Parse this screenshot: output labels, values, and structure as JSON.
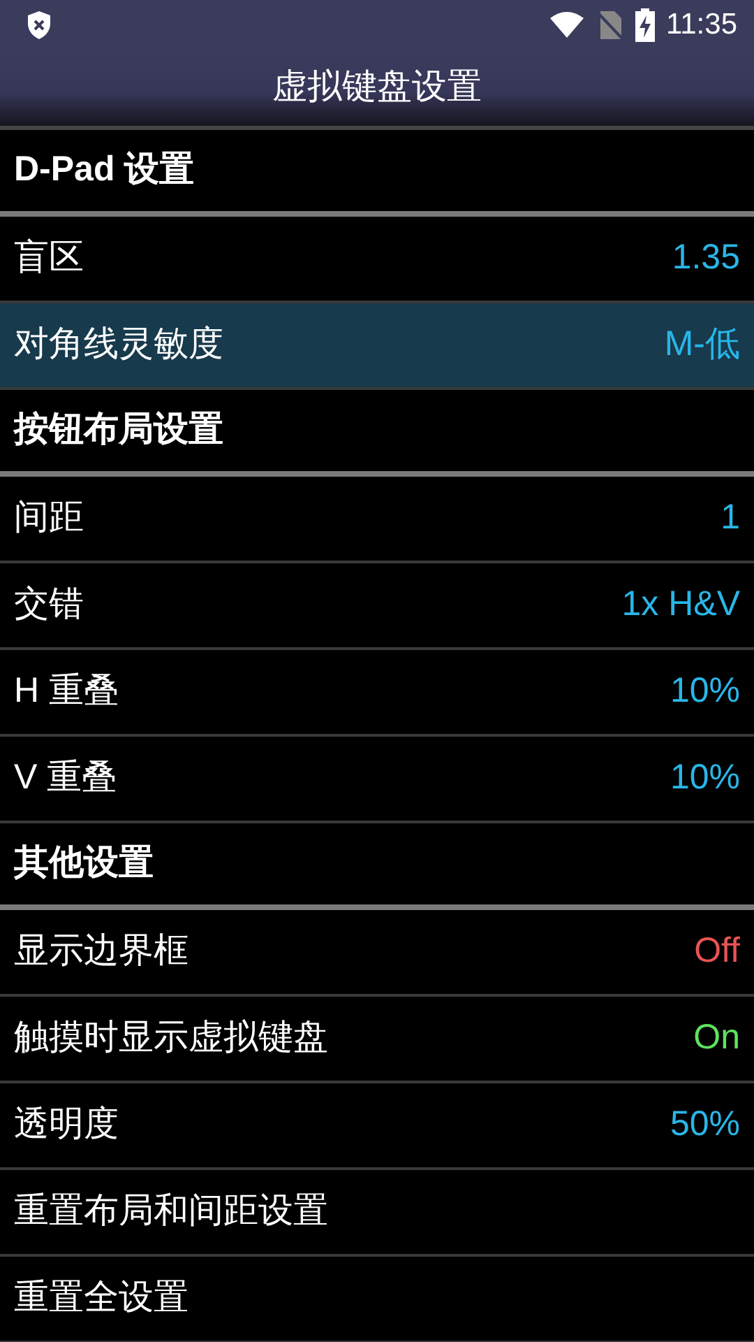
{
  "status_bar": {
    "time": "11:35"
  },
  "title": "虚拟键盘设置",
  "items": [
    {
      "kind": "header",
      "label": "D-Pad 设置"
    },
    {
      "kind": "setting",
      "label": "盲区",
      "value": "1.35",
      "color": "#29b6e8",
      "selected": false
    },
    {
      "kind": "setting",
      "label": "对角线灵敏度",
      "value": "M-低",
      "color": "#29b6e8",
      "selected": true
    },
    {
      "kind": "header",
      "label": "按钮布局设置"
    },
    {
      "kind": "setting",
      "label": "间距",
      "value": "1",
      "color": "#29b6e8",
      "selected": false
    },
    {
      "kind": "setting",
      "label": "交错",
      "value": "1x H&V",
      "color": "#29b6e8",
      "selected": false
    },
    {
      "kind": "setting",
      "label": "H 重叠",
      "value": "10%",
      "color": "#29b6e8",
      "selected": false
    },
    {
      "kind": "setting",
      "label": "V 重叠",
      "value": "10%",
      "color": "#29b6e8",
      "selected": false
    },
    {
      "kind": "header",
      "label": "其他设置"
    },
    {
      "kind": "setting",
      "label": "显示边界框",
      "value": "Off",
      "color": "#e85454",
      "selected": false
    },
    {
      "kind": "setting",
      "label": "触摸时显示虚拟键盘",
      "value": "On",
      "color": "#5ee25e",
      "selected": false
    },
    {
      "kind": "setting",
      "label": "透明度",
      "value": "50%",
      "color": "#29b6e8",
      "selected": false
    },
    {
      "kind": "setting",
      "label": "重置布局和间距设置",
      "selected": false
    },
    {
      "kind": "setting",
      "label": "重置全设置",
      "selected": false
    }
  ]
}
